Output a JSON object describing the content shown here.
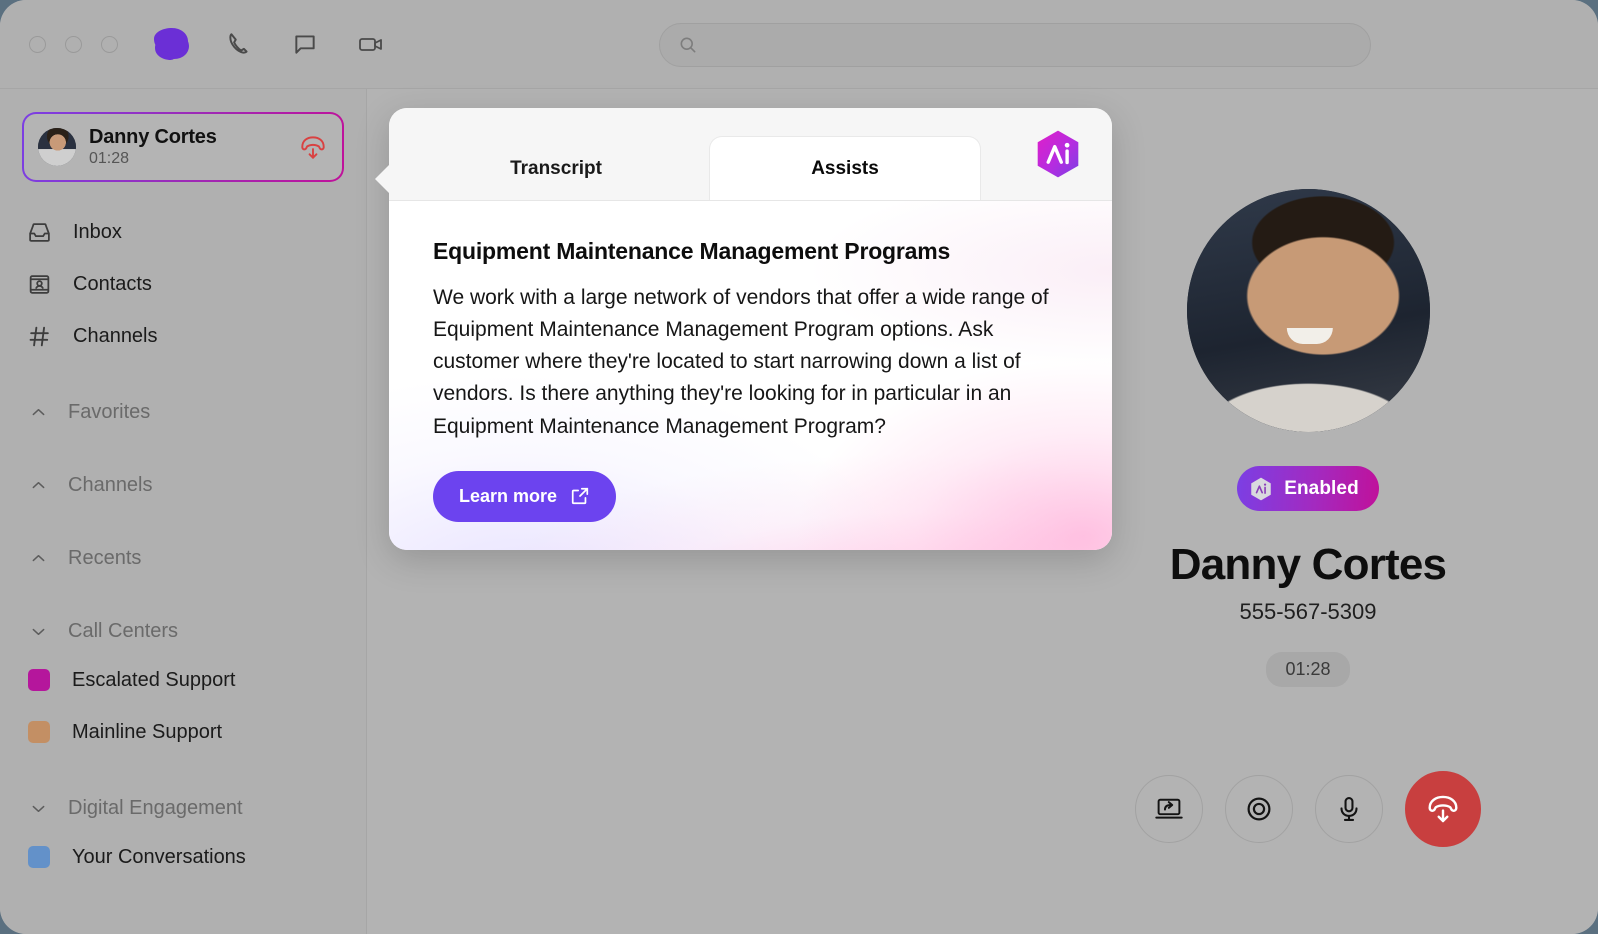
{
  "window": {
    "traffic_lights": [
      "close",
      "minimize",
      "maximize"
    ],
    "brand": "nice-cxone-logo"
  },
  "titlebar": {
    "icons": [
      {
        "name": "phone-icon",
        "label": "Phone"
      },
      {
        "name": "chat-icon",
        "label": "Chat"
      },
      {
        "name": "video-icon",
        "label": "Video"
      }
    ]
  },
  "search": {
    "value": "",
    "placeholder": "",
    "icon": "search-icon"
  },
  "sidebar": {
    "active_call": {
      "name": "Danny Cortes",
      "duration": "01:28",
      "hangup_icon": "hangup-down-icon",
      "avatar": "avatar"
    },
    "nav_items": [
      {
        "label": "Inbox",
        "icon": "inbox-icon"
      },
      {
        "label": "Contacts",
        "icon": "contacts-icon"
      },
      {
        "label": "Channels",
        "icon": "hash-icon"
      }
    ],
    "sections": [
      {
        "label": "Favorites",
        "chevron": "chevron-up-icon",
        "expanded": false,
        "items": []
      },
      {
        "label": "Channels",
        "chevron": "chevron-up-icon",
        "expanded": false,
        "items": []
      },
      {
        "label": "Recents",
        "chevron": "chevron-up-icon",
        "expanded": false,
        "items": []
      },
      {
        "label": "Call Centers",
        "chevron": "chevron-down-icon",
        "expanded": true,
        "items": [
          {
            "label": "Escalated Support",
            "color": "#b5169c"
          },
          {
            "label": "Mainline Support",
            "color": "#c38f64"
          }
        ]
      },
      {
        "label": "Digital Engagement",
        "chevron": "chevron-down-icon",
        "expanded": true,
        "items": [
          {
            "label": "Your Conversations",
            "color": "#6391c9"
          }
        ]
      }
    ]
  },
  "assist_card": {
    "tabs": [
      {
        "label": "Transcript",
        "active": false
      },
      {
        "label": "Assists",
        "active": true
      }
    ],
    "ai_badge_icon": "ai-hexagon-icon",
    "title": "Equipment Maintenance Management Programs",
    "body": "We work with a large network of vendors that offer a wide range of Equipment Maintenance Management Program options. Ask customer where they're located to start narrowing down a list of vendors. Is there anything they're looking for in particular in an Equipment Maintenance Management Program?",
    "learn_more_label": "Learn more",
    "learn_more_icon": "external-link-icon",
    "learn_more_color": "#6c43ef"
  },
  "contact": {
    "photo": "contact-photo",
    "ai_status": {
      "label": "Enabled",
      "icon": "ai-hexagon-icon",
      "gradient_from": "#7b3fe4",
      "gradient_to": "#c0119a"
    },
    "name": "Danny Cortes",
    "phone": "555-567-5309",
    "duration": "01:28"
  },
  "call_controls": [
    {
      "name": "screen-share-button",
      "icon": "screen-share-icon"
    },
    {
      "name": "record-button",
      "icon": "record-circle-icon"
    },
    {
      "name": "mute-button",
      "icon": "microphone-icon"
    },
    {
      "name": "end-call-button",
      "icon": "hangup-down-icon",
      "color": "#c83f3f"
    }
  ]
}
